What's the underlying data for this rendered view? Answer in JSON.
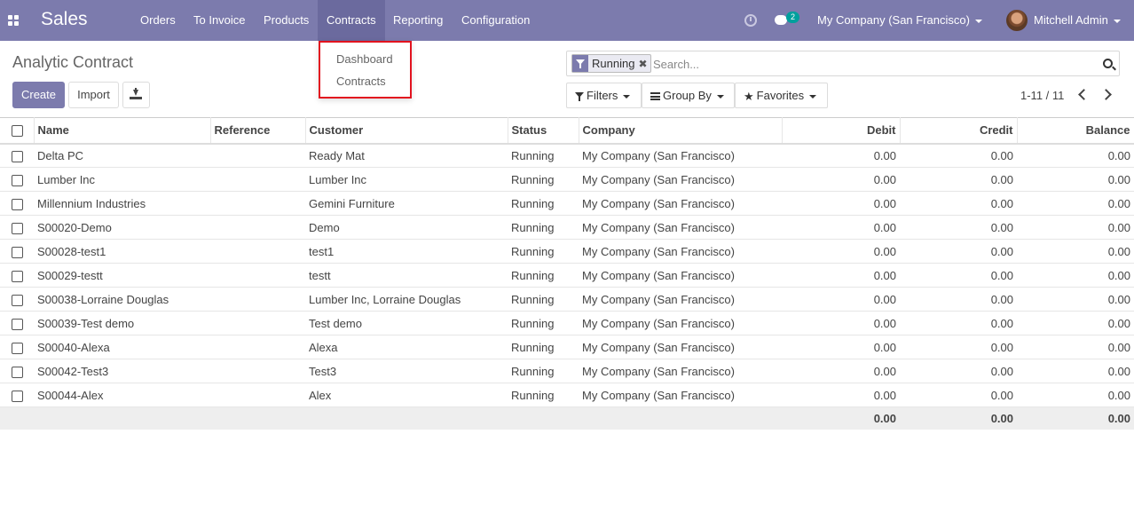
{
  "navbar": {
    "app_name": "Sales",
    "menu": [
      "Orders",
      "To Invoice",
      "Products",
      "Contracts",
      "Reporting",
      "Configuration"
    ],
    "active_menu": "Contracts",
    "message_count": "2",
    "company": "My Company (San Francisco)",
    "user": "Mitchell Admin"
  },
  "dropdown": {
    "items": [
      "Dashboard",
      "Contracts"
    ]
  },
  "control_panel": {
    "title": "Analytic Contract",
    "create_label": "Create",
    "import_label": "Import",
    "search": {
      "facet": "Running",
      "placeholder": "Search..."
    },
    "filters_label": "Filters",
    "groupby_label": "Group By",
    "favorites_label": "Favorites",
    "pager": "1-11 / 11"
  },
  "table": {
    "columns": [
      "Name",
      "Reference",
      "Customer",
      "Status",
      "Company",
      "Debit",
      "Credit",
      "Balance"
    ],
    "rows": [
      {
        "name": "Delta PC",
        "reference": "",
        "customer": "Ready Mat",
        "status": "Running",
        "company": "My Company (San Francisco)",
        "debit": "0.00",
        "credit": "0.00",
        "balance": "0.00"
      },
      {
        "name": "Lumber Inc",
        "reference": "",
        "customer": "Lumber Inc",
        "status": "Running",
        "company": "My Company (San Francisco)",
        "debit": "0.00",
        "credit": "0.00",
        "balance": "0.00"
      },
      {
        "name": "Millennium Industries",
        "reference": "",
        "customer": "Gemini Furniture",
        "status": "Running",
        "company": "My Company (San Francisco)",
        "debit": "0.00",
        "credit": "0.00",
        "balance": "0.00"
      },
      {
        "name": "S00020-Demo",
        "reference": "",
        "customer": "Demo",
        "status": "Running",
        "company": "My Company (San Francisco)",
        "debit": "0.00",
        "credit": "0.00",
        "balance": "0.00"
      },
      {
        "name": "S00028-test1",
        "reference": "",
        "customer": "test1",
        "status": "Running",
        "company": "My Company (San Francisco)",
        "debit": "0.00",
        "credit": "0.00",
        "balance": "0.00"
      },
      {
        "name": "S00029-testt",
        "reference": "",
        "customer": "testt",
        "status": "Running",
        "company": "My Company (San Francisco)",
        "debit": "0.00",
        "credit": "0.00",
        "balance": "0.00"
      },
      {
        "name": "S00038-Lorraine Douglas",
        "reference": "",
        "customer": "Lumber Inc, Lorraine Douglas",
        "status": "Running",
        "company": "My Company (San Francisco)",
        "debit": "0.00",
        "credit": "0.00",
        "balance": "0.00"
      },
      {
        "name": "S00039-Test demo",
        "reference": "",
        "customer": "Test demo",
        "status": "Running",
        "company": "My Company (San Francisco)",
        "debit": "0.00",
        "credit": "0.00",
        "balance": "0.00"
      },
      {
        "name": "S00040-Alexa",
        "reference": "",
        "customer": "Alexa",
        "status": "Running",
        "company": "My Company (San Francisco)",
        "debit": "0.00",
        "credit": "0.00",
        "balance": "0.00"
      },
      {
        "name": "S00042-Test3",
        "reference": "",
        "customer": "Test3",
        "status": "Running",
        "company": "My Company (San Francisco)",
        "debit": "0.00",
        "credit": "0.00",
        "balance": "0.00"
      },
      {
        "name": "S00044-Alex",
        "reference": "",
        "customer": "Alex",
        "status": "Running",
        "company": "My Company (San Francisco)",
        "debit": "0.00",
        "credit": "0.00",
        "balance": "0.00"
      }
    ],
    "totals": {
      "debit": "0.00",
      "credit": "0.00",
      "balance": "0.00"
    }
  },
  "colors": {
    "brand": "#7c7bad",
    "highlight": "#e2131f",
    "badge": "#00a09d"
  }
}
